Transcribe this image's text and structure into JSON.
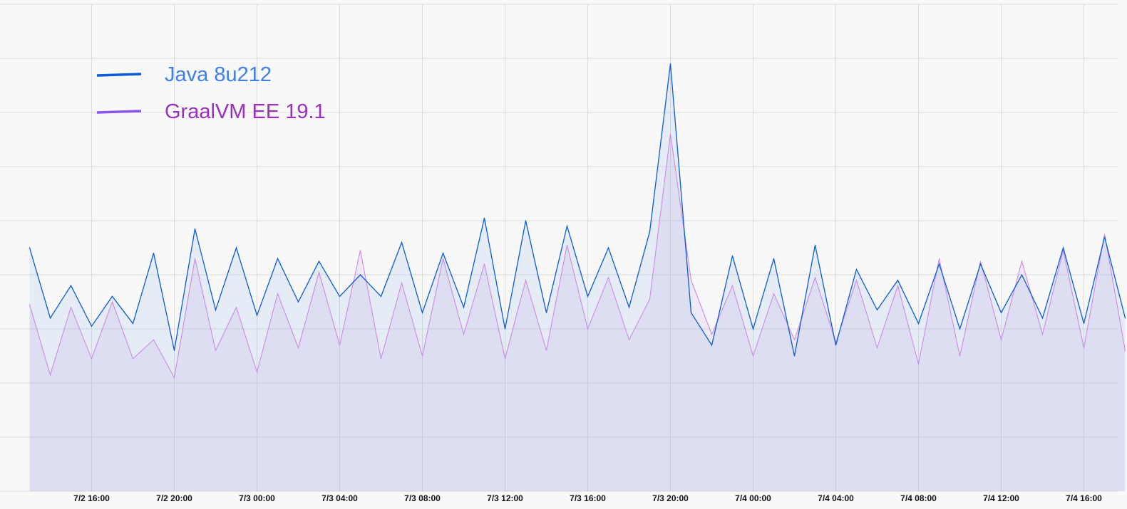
{
  "chart_data": {
    "type": "line",
    "legend_position": "top-left",
    "grid": true,
    "x_tick_labels": [
      "7/2 16:00",
      "7/2 20:00",
      "7/3 00:00",
      "7/3 04:00",
      "7/3 08:00",
      "7/3 12:00",
      "7/3 16:00",
      "7/3 20:00",
      "7/4 00:00",
      "7/4 04:00",
      "7/4 08:00",
      "7/4 12:00",
      "7/4 16:00"
    ],
    "x_tick_hours": [
      16,
      20,
      24,
      28,
      32,
      36,
      40,
      44,
      48,
      52,
      56,
      60,
      64
    ],
    "ylim": [
      0,
      9
    ],
    "xlim_hours": [
      12.5,
      66
    ],
    "series": [
      {
        "name": "Java 8u212",
        "color": "#0a5bd8",
        "label_color": "#3f7fe6",
        "fill": "rgba(120,160,230,0.14)",
        "x_hours": [
          13,
          14,
          15,
          16,
          17,
          18,
          19,
          20,
          21,
          22,
          23,
          24,
          25,
          26,
          27,
          28,
          29,
          30,
          31,
          32,
          33,
          34,
          35,
          36,
          37,
          38,
          39,
          40,
          41,
          42,
          43,
          44,
          45,
          46,
          47,
          48,
          49,
          50,
          51,
          52,
          53,
          54,
          55,
          56,
          57,
          58,
          59,
          60,
          61,
          62,
          63,
          64,
          65,
          66
        ],
        "values": [
          4.5,
          3.2,
          3.8,
          3.05,
          3.6,
          3.1,
          4.4,
          2.6,
          4.85,
          3.35,
          4.5,
          3.25,
          4.3,
          3.5,
          4.25,
          3.6,
          4.0,
          3.6,
          4.6,
          3.3,
          4.4,
          3.4,
          5.05,
          3.0,
          5.0,
          3.3,
          4.9,
          3.6,
          4.5,
          3.4,
          4.8,
          7.9,
          3.3,
          2.7,
          4.35,
          3.0,
          4.3,
          2.5,
          4.55,
          2.7,
          4.1,
          3.35,
          3.9,
          3.1,
          4.2,
          3.0,
          4.2,
          3.3,
          4.0,
          3.2,
          4.5,
          3.1,
          4.7,
          3.2
        ]
      },
      {
        "name": "GraalVM EE 19.1",
        "color": "#cc8be6",
        "label_color": "#9b2fbe",
        "fill": "rgba(170,130,225,0.13)",
        "x_hours": [
          13,
          14,
          15,
          16,
          17,
          18,
          19,
          20,
          21,
          22,
          23,
          24,
          25,
          26,
          27,
          28,
          29,
          30,
          31,
          32,
          33,
          34,
          35,
          36,
          37,
          38,
          39,
          40,
          41,
          42,
          43,
          44,
          45,
          46,
          47,
          48,
          49,
          50,
          51,
          52,
          53,
          54,
          55,
          56,
          57,
          58,
          59,
          60,
          61,
          62,
          63,
          64,
          65,
          66
        ],
        "values": [
          3.45,
          2.15,
          3.4,
          2.45,
          3.5,
          2.45,
          2.8,
          2.1,
          4.3,
          2.6,
          3.4,
          2.2,
          3.65,
          2.65,
          4.05,
          2.7,
          4.45,
          2.45,
          3.85,
          2.5,
          4.3,
          2.9,
          4.2,
          2.45,
          3.9,
          2.6,
          4.55,
          3.0,
          3.95,
          2.8,
          3.55,
          6.6,
          3.9,
          2.9,
          3.8,
          2.5,
          3.65,
          2.8,
          3.95,
          2.75,
          3.9,
          2.65,
          3.8,
          2.35,
          4.3,
          2.5,
          4.25,
          2.8,
          4.25,
          2.9,
          4.45,
          2.65,
          4.75,
          2.6
        ]
      }
    ]
  }
}
